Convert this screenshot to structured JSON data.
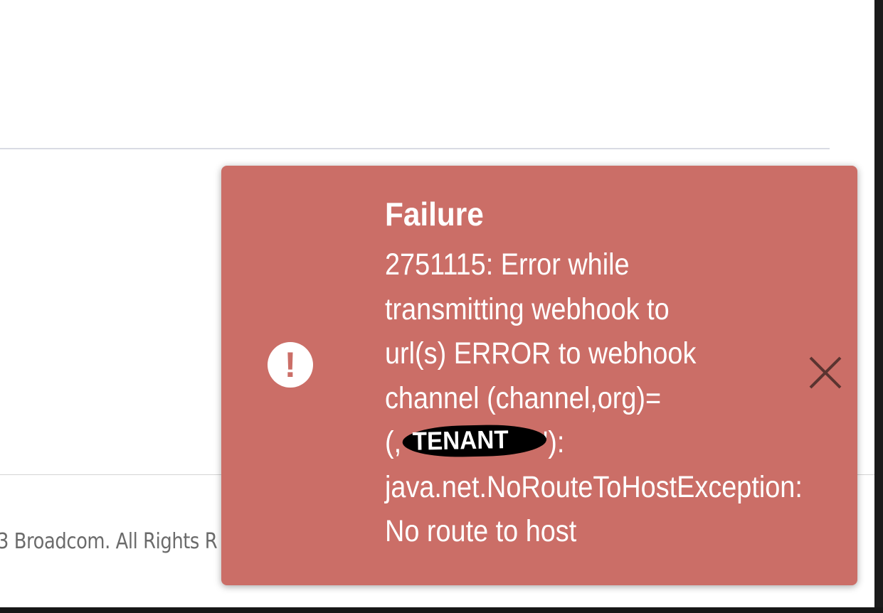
{
  "footer": {
    "copyright_text": "3 Broadcom. All Rights R"
  },
  "notification": {
    "type": "failure",
    "icon": "exclamation-circle-icon",
    "title": "Failure",
    "message_lines": [
      "2751115: Error while",
      "transmitting webhook to",
      "url(s) ERROR to webhook",
      "channel (channel,org)=",
      "java.net.NoRouteToHostException:",
      "No route to host"
    ],
    "redacted_line": {
      "prefix": "(,",
      "redaction_label": "TENANT",
      "suffix": "'):"
    },
    "close_icon": "close-icon",
    "background_color": "#cb6e67",
    "text_color": "#ffffff"
  }
}
